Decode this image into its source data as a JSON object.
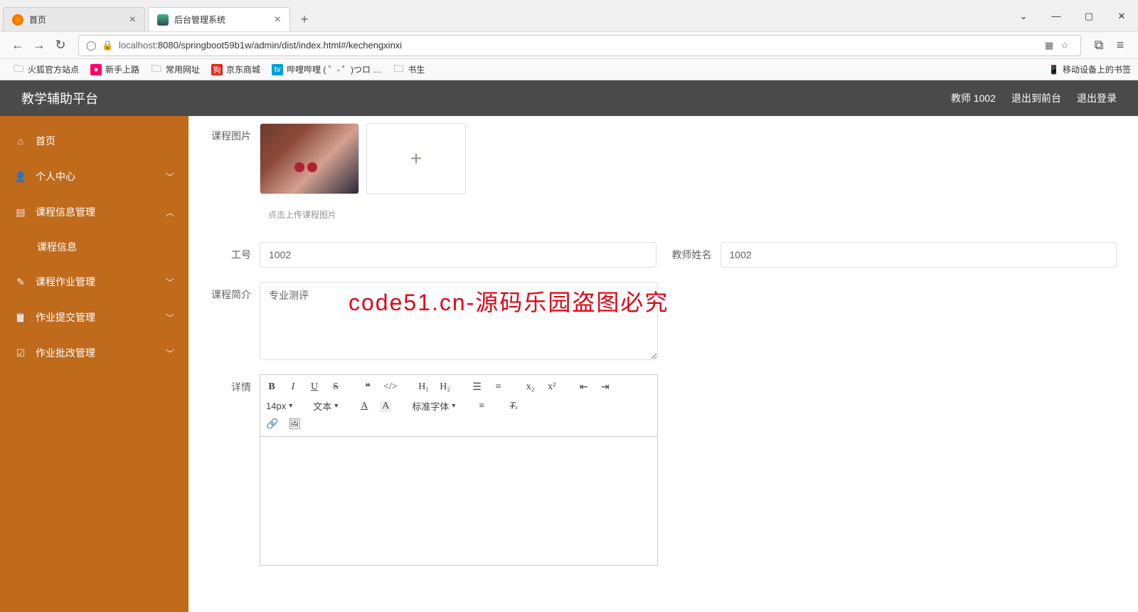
{
  "browser": {
    "tabs": [
      {
        "label": "首页",
        "active": false
      },
      {
        "label": "后台管理系统",
        "active": true
      }
    ],
    "url_host": "localhost",
    "url_port_path": ":8080/springboot59b1w/admin/dist/index.html#/kechengxinxi",
    "bookmarks": [
      {
        "label": "火狐官方站点",
        "icon": "ff"
      },
      {
        "label": "新手上路",
        "icon": "ghost"
      },
      {
        "label": "常用网址",
        "icon": "folder"
      },
      {
        "label": "京东商城",
        "icon": "jd"
      },
      {
        "label": "哔哩哔哩 ( ゜- ゜)つロ …",
        "icon": "bili"
      },
      {
        "label": "书生",
        "icon": "folder"
      }
    ],
    "bookmark_right": "移动设备上的书签"
  },
  "header": {
    "title": "教学辅助平台",
    "user": "教师 1002",
    "back": "退出到前台",
    "logout": "退出登录"
  },
  "sidebar": {
    "items": [
      {
        "icon": "⌂",
        "label": "首页",
        "expandable": false
      },
      {
        "icon": "👤",
        "label": "个人中心",
        "expandable": true,
        "open": false
      },
      {
        "icon": "▤",
        "label": "课程信息管理",
        "expandable": true,
        "open": true,
        "children": [
          {
            "label": "课程信息"
          }
        ]
      },
      {
        "icon": "✎",
        "label": "课程作业管理",
        "expandable": true,
        "open": false
      },
      {
        "icon": "📋",
        "label": "作业提交管理",
        "expandable": true,
        "open": false
      },
      {
        "icon": "✓",
        "label": "作业批改管理",
        "expandable": true,
        "open": false
      }
    ]
  },
  "form": {
    "image_label": "课程图片",
    "image_help": "点击上传课程图片",
    "gonghao_label": "工号",
    "gonghao_value": "1002",
    "jiaoshi_label": "教师姓名",
    "jiaoshi_value": "1002",
    "jianjie_label": "课程简介",
    "jianjie_value": "专业测评",
    "detail_label": "详情"
  },
  "editor": {
    "font_size": "14px",
    "text_style": "文本",
    "font_family": "标准字体"
  },
  "watermark": {
    "text": "code51.cn",
    "banner": "code51.cn-源码乐园盗图必究"
  }
}
